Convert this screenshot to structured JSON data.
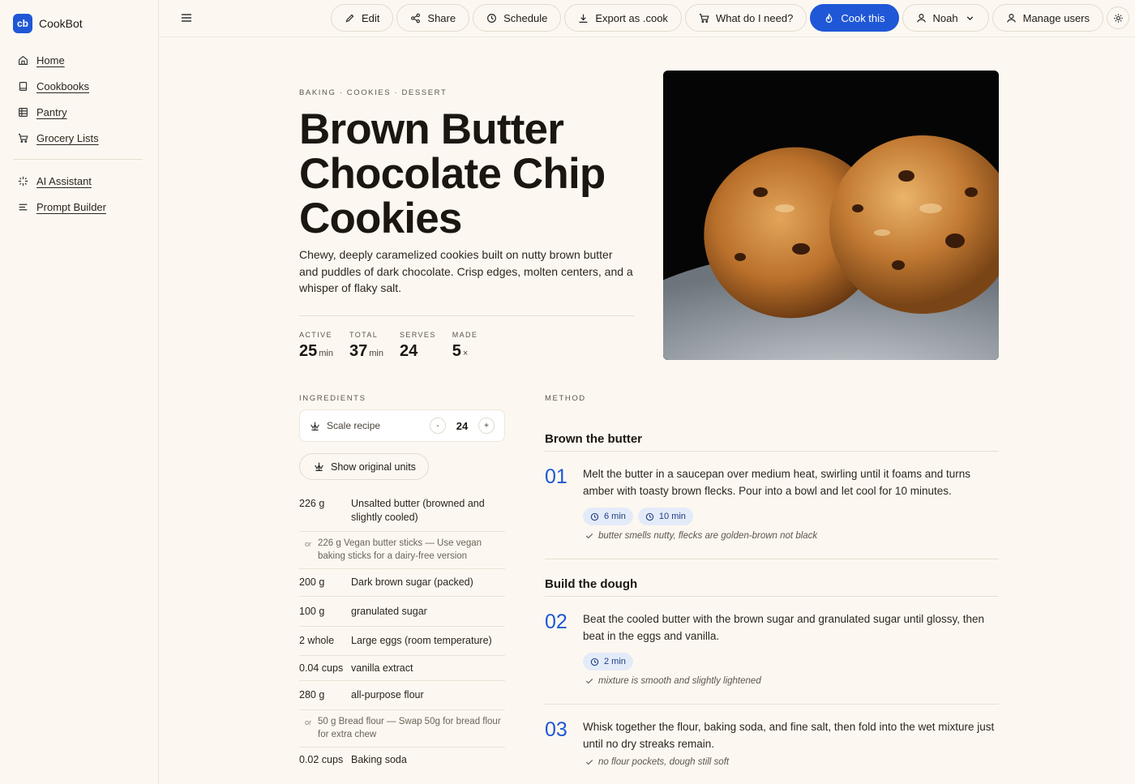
{
  "brand": {
    "logo": "cb",
    "name": "CookBot"
  },
  "sidebar": {
    "items": [
      {
        "label": "Home",
        "icon": "home-icon"
      },
      {
        "label": "Cookbooks",
        "icon": "book-icon"
      },
      {
        "label": "Pantry",
        "icon": "grid-icon"
      },
      {
        "label": "Grocery Lists",
        "icon": "cart-icon"
      }
    ],
    "tools": [
      {
        "label": "AI Assistant",
        "icon": "sparkle-icon"
      },
      {
        "label": "Prompt Builder",
        "icon": "lines-icon"
      }
    ]
  },
  "toolbar": {
    "edit": "Edit",
    "share": "Share",
    "schedule": "Schedule",
    "export": "Export as .cook",
    "need": "What do I need?",
    "cook": "Cook this",
    "user": "Noah",
    "manage": "Manage users"
  },
  "recipe": {
    "crumbs": "BAKING · COOKIES · DESSERT",
    "title": "Brown Butter Chocolate Chip Cookies",
    "description": "Chewy, deeply caramelized cookies built on nutty brown butter and puddles of dark chocolate. Crisp edges, molten centers, and a whisper of flaky salt.",
    "stats": [
      {
        "key": "ACTIVE",
        "value": "25",
        "unit": "min"
      },
      {
        "key": "TOTAL",
        "value": "37",
        "unit": "min"
      },
      {
        "key": "SERVES",
        "value": "24",
        "unit": ""
      },
      {
        "key": "MADE",
        "value": "5",
        "unit": "×"
      }
    ]
  },
  "ingredients": {
    "label": "INGREDIENTS",
    "scale_label": "Scale recipe",
    "scale_value": "24",
    "minus": "-",
    "plus": "+",
    "original_units": "Show original units",
    "items": [
      {
        "q": "226 g",
        "n": "Unsalted butter (browned and slightly cooled)"
      },
      {
        "sub": true,
        "or": "or",
        "n": "226 g Vegan butter sticks — Use vegan baking sticks for a dairy-free version"
      },
      {
        "q": "200 g",
        "n": "Dark brown sugar (packed)"
      },
      {
        "q": "100 g",
        "n": "granulated sugar"
      },
      {
        "q": "2 whole",
        "n": "Large eggs (room temperature)"
      },
      {
        "q": "0.04 cups",
        "n": "vanilla extract"
      },
      {
        "q": "280 g",
        "n": "all-purpose flour"
      },
      {
        "sub": true,
        "or": "or",
        "n": "50 g Bread flour — Swap 50g for bread flour for extra chew"
      },
      {
        "q": "0.02 cups",
        "n": "Baking soda"
      }
    ]
  },
  "method": {
    "label": "METHOD",
    "sections": [
      {
        "head": "Brown the butter",
        "num": "01",
        "text": "Melt the butter in a saucepan over medium heat, swirling until it foams and turns amber with toasty brown flecks. Pour into a bowl and let cool for 10 minutes.",
        "timers": [
          "6 min",
          "10 min"
        ],
        "check": "butter smells nutty, flecks are golden-brown not black"
      },
      {
        "head": "Build the dough",
        "num": "02",
        "text": "Beat the cooled butter with the brown sugar and granulated sugar until glossy, then beat in the eggs and vanilla.",
        "timers": [
          "2 min"
        ],
        "check": "mixture is smooth and slightly lightened"
      },
      {
        "head": "",
        "num": "03",
        "text": "Whisk together the flour, baking soda, and fine salt, then fold into the wet mixture just until no dry streaks remain.",
        "timers": [],
        "check": "no flour pockets, dough still soft"
      }
    ]
  },
  "colors": {
    "accent": "#1f57d6",
    "background": "#fcf8f1",
    "timer_bg": "#e4ebf8"
  }
}
